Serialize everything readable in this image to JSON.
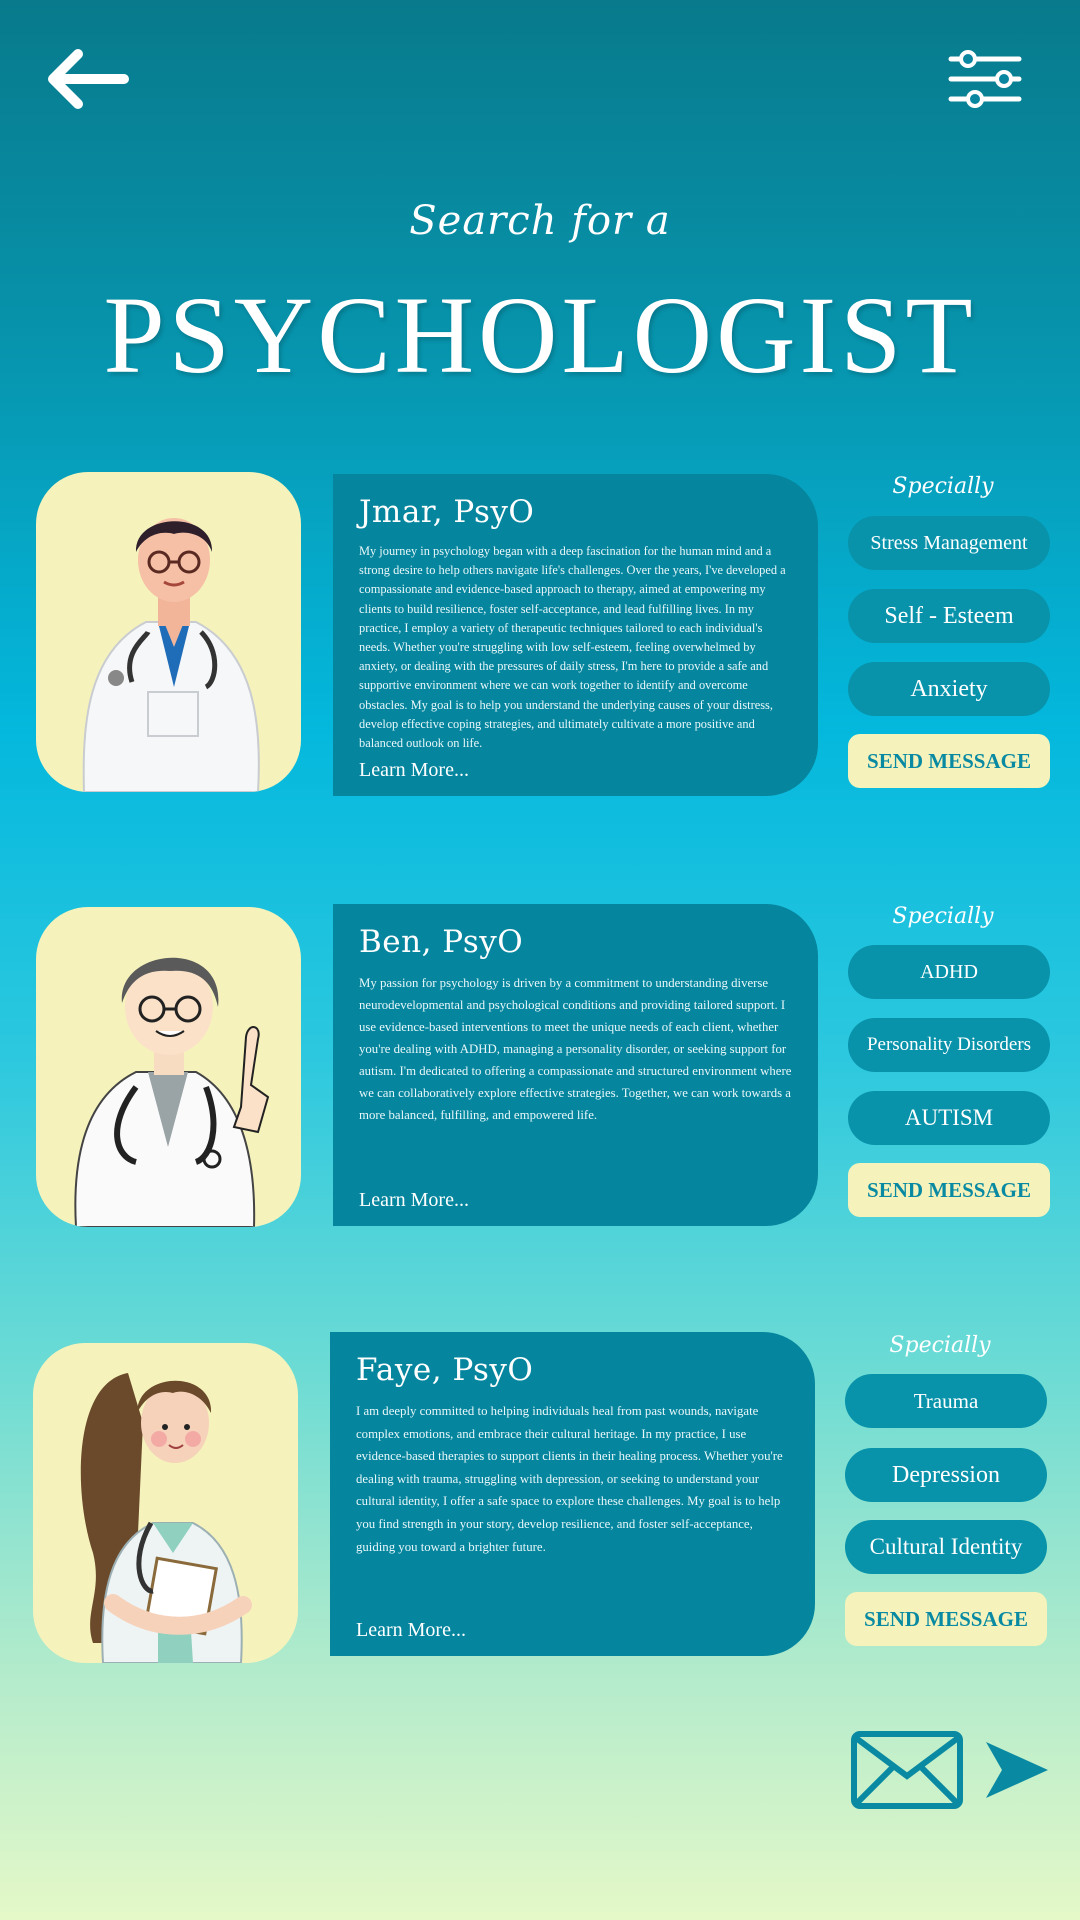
{
  "header": {
    "subtitle": "Search for a",
    "title": "PSYCHOLOGIST"
  },
  "icons": {
    "back": "arrow-left-icon",
    "filter": "sliders-icon",
    "mail": "envelope-icon",
    "send": "paper-plane-icon"
  },
  "colors": {
    "card": "#05869e",
    "chip": "#0893ab",
    "portrait_bg": "#f5f3bb",
    "send_button_bg": "#f5f3bb",
    "send_button_text": "#0a8aa2"
  },
  "psychologists": [
    {
      "name": "Jmar, PsyO",
      "bio": "My journey in psychology began with a deep fascination for the human mind and a strong desire to help others navigate life's challenges. Over the years, I've developed a compassionate and evidence-based approach to therapy, aimed at empowering my clients to build resilience, foster self-acceptance, and lead fulfilling lives. In my practice, I employ a variety of therapeutic techniques tailored to each individual's needs. Whether you're struggling with low self-esteem, feeling overwhelmed by anxiety, or dealing with the pressures of daily stress, I'm here to provide a safe and supportive environment where we can work together to identify and overcome obstacles. My goal is to help you understand the underlying causes of your distress, develop effective coping strategies, and ultimately cultivate a more positive and balanced outlook on life.",
      "learn_more": "Learn More...",
      "specialty_label": "Specially",
      "specialties": [
        "Stress Management",
        "Self - Esteem",
        "Anxiety"
      ],
      "send_label": "SEND MESSAGE"
    },
    {
      "name": "Ben, PsyO",
      "bio": "My passion for psychology is driven by a commitment to understanding diverse neurodevelopmental and psychological conditions and providing tailored support. I use evidence-based interventions to meet the unique needs of each client, whether you're dealing with ADHD, managing a personality disorder, or seeking support for autism. I'm dedicated to offering a compassionate and structured environment where we can collaboratively explore effective strategies. Together, we can work towards a more balanced, fulfilling, and empowered life.",
      "learn_more": "Learn More...",
      "specialty_label": "Specially",
      "specialties": [
        "ADHD",
        "Personality Disorders",
        "AUTISM"
      ],
      "send_label": "SEND MESSAGE"
    },
    {
      "name": "Faye, PsyO",
      "bio": "I am deeply committed to helping individuals heal from past wounds, navigate complex emotions, and embrace their cultural heritage. In my practice, I use evidence-based therapies to support clients in their healing process. Whether you're dealing with trauma, struggling with depression, or seeking to understand your cultural identity, I offer a safe space to explore these challenges. My goal is to help you find strength in your story, develop resilience, and foster self-acceptance, guiding you toward a brighter future.",
      "learn_more": "Learn More...",
      "specialty_label": "Specially",
      "specialties": [
        "Trauma",
        "Depression",
        "Cultural Identity"
      ],
      "send_label": "SEND MESSAGE"
    }
  ]
}
